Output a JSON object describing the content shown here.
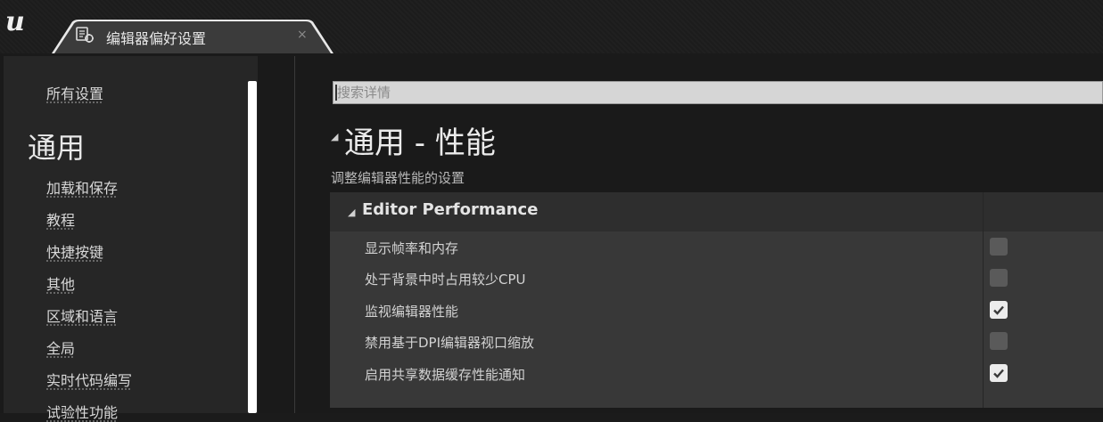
{
  "app": {
    "logo": "unreal-engine-logo",
    "tab": {
      "title": "编辑器偏好设置",
      "close": "×",
      "icon": "settings-editor-icon"
    }
  },
  "sidebar": {
    "all_settings": "所有设置",
    "section_title": "通用",
    "items": [
      {
        "label": "加载和保存"
      },
      {
        "label": "教程"
      },
      {
        "label": "快捷按键"
      },
      {
        "label": "其他"
      },
      {
        "label": "区域和语言"
      },
      {
        "label": "全局"
      },
      {
        "label": "实时代码编写"
      },
      {
        "label": "试验性功能"
      }
    ]
  },
  "search": {
    "placeholder": "搜索详情",
    "value": ""
  },
  "main": {
    "heading": "通用 - 性能",
    "subheading": "调整编辑器性能的设置",
    "category": {
      "title": "Editor Performance",
      "properties": [
        {
          "label": "显示帧率和内存",
          "checked": false
        },
        {
          "label": "处于背景中时占用较少CPU",
          "checked": false
        },
        {
          "label": "监视编辑器性能",
          "checked": true
        },
        {
          "label": "禁用基于DPI编辑器视口缩放",
          "checked": false
        },
        {
          "label": "启用共享数据缓存性能通知",
          "checked": true
        }
      ]
    }
  },
  "colors": {
    "background": "#1a1a1a",
    "sidebar": "#262626",
    "panel": "#383838",
    "panel_header": "#2e2e2e",
    "checkbox_unchecked": "#5a5a5a",
    "checkbox_checked": "#ececec"
  }
}
